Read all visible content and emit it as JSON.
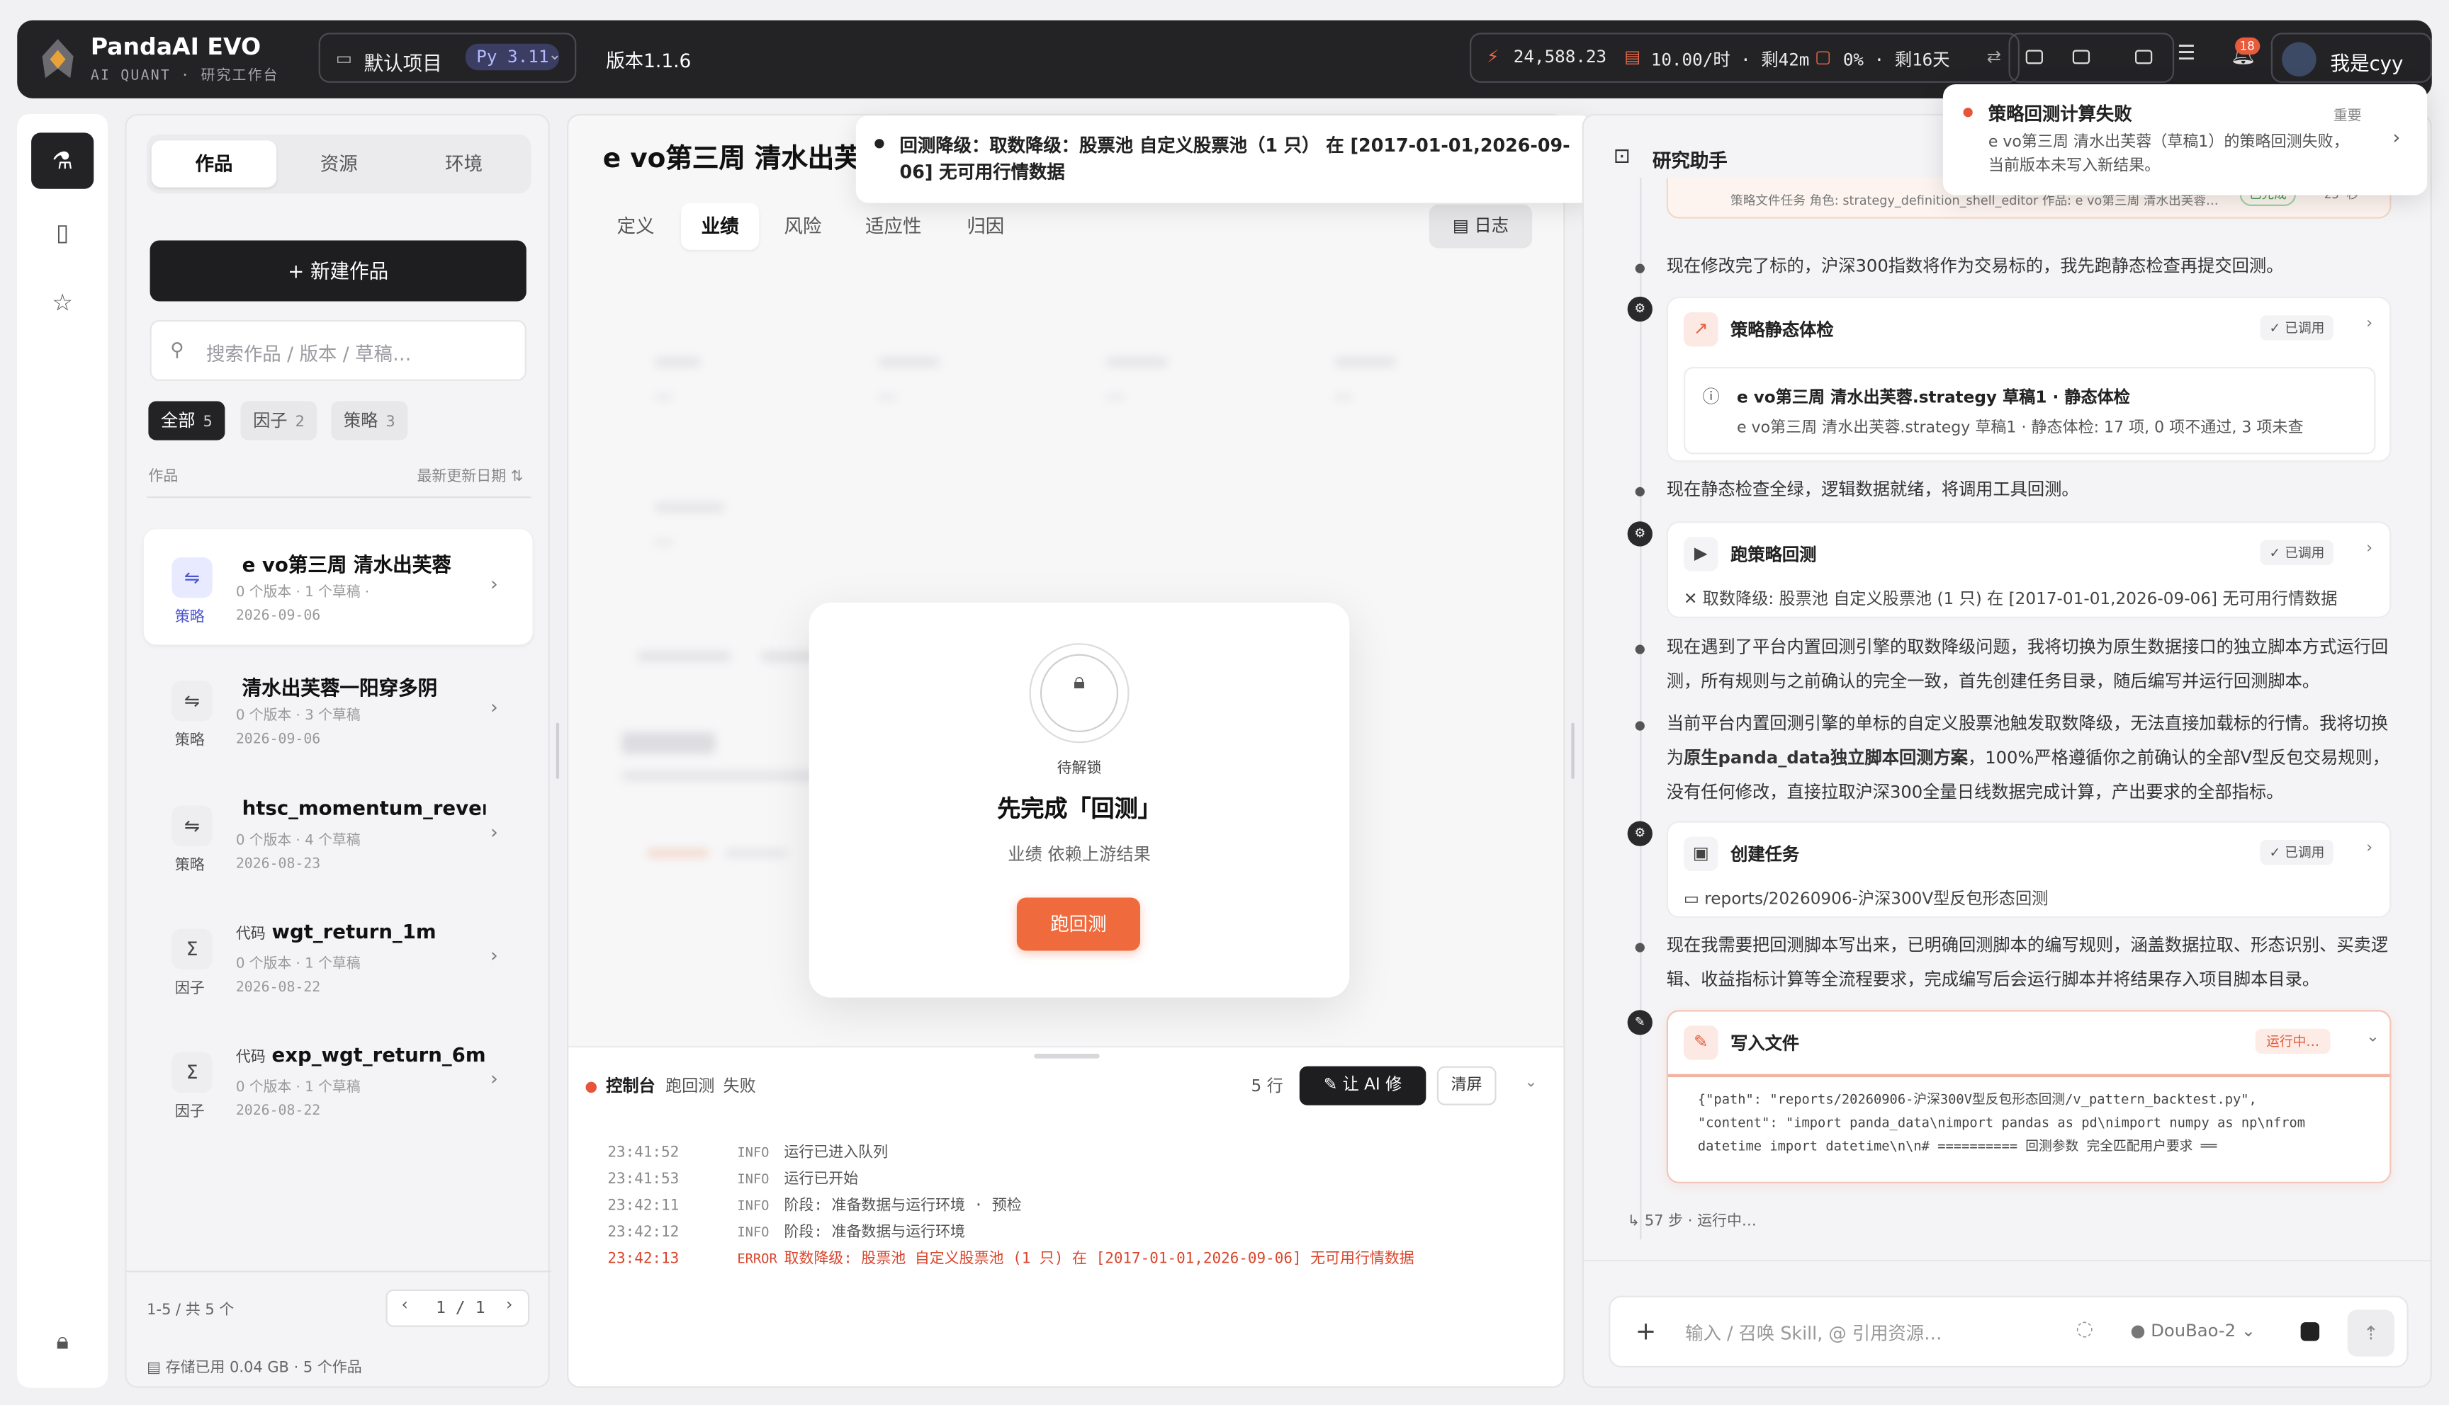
{
  "topbar": {
    "brand": "PandaAI EVO",
    "brand_sub": "AI QUANT · 研究工作台",
    "project_name": "默认项目",
    "python_version": "Py 3.11",
    "version": "版本1.1.6",
    "balance": "24,588.23",
    "rate": "10.00/时 · 剩42m",
    "usage": "0% · 剩16天",
    "notification_count": "18",
    "username": "我是cyy"
  },
  "rail": {
    "items": [
      "flask-icon",
      "notebook-icon",
      "star-icon"
    ],
    "bottom": "lock-icon"
  },
  "left_panel": {
    "tabs": [
      "作品",
      "资源",
      "环境"
    ],
    "active_tab": "作品",
    "new_button": "+ 新建作品",
    "search_placeholder": "搜索作品 / 版本 / 草稿…",
    "filters": [
      {
        "label": "全部",
        "count": "5"
      },
      {
        "label": "因子",
        "count": "2"
      },
      {
        "label": "策略",
        "count": "3"
      }
    ],
    "list_header_left": "作品",
    "list_header_right": "最新更新日期 ⇅",
    "items": [
      {
        "title": "e vo第三周 清水出芙蓉",
        "tag": "",
        "meta": "0 个版本 · 1 个草稿 ·",
        "date": "2026-09-06",
        "type": "策略",
        "icon": "⇋"
      },
      {
        "title": "清水出芙蓉一阳穿多阴",
        "tag": "",
        "meta": "0 个版本 · 3 个草稿",
        "date": "2026-09-06",
        "type": "策略",
        "icon": "⇋"
      },
      {
        "title": "htsc_momentum_revers…",
        "tag": "",
        "meta": "0 个版本 · 4 个草稿",
        "date": "2026-08-23",
        "type": "策略",
        "icon": "⇋"
      },
      {
        "title": "wgt_return_1m",
        "tag": "代码",
        "meta": "0 个版本 · 1 个草稿",
        "date": "2026-08-22",
        "type": "因子",
        "icon": "Σ"
      },
      {
        "title": "exp_wgt_return_6m",
        "tag": "代码",
        "meta": "0 个版本 · 1 个草稿",
        "date": "2026-08-22",
        "type": "因子",
        "icon": "Σ"
      }
    ],
    "pager_text": "1-5 / 共 5 个",
    "page": "1 / 1",
    "storage": "存储已用 0.04 GB · 5 个作品"
  },
  "main": {
    "title": "e vo第三周 清水出芙蓉",
    "tabs": [
      "定义",
      "业绩",
      "风险",
      "适应性",
      "归因"
    ],
    "active_tab": "业绩",
    "log_button": "日志",
    "modal": {
      "label": "待解锁",
      "heading": "先完成「回测」",
      "subtitle": "业绩 依赖上游结果",
      "button": "跑回测"
    },
    "console": {
      "title": "控制台",
      "task": "跑回测",
      "status": "失败",
      "rows": "5 行",
      "ai_fix": "让 AI 修",
      "clear": "清屏",
      "logs": [
        {
          "time": "23:41:52",
          "level": "INFO",
          "msg": "运行已进入队列"
        },
        {
          "time": "23:41:53",
          "level": "INFO",
          "msg": "运行已开始"
        },
        {
          "time": "23:42:11",
          "level": "INFO",
          "msg": "阶段: 准备数据与运行环境 · 预检"
        },
        {
          "time": "23:42:12",
          "level": "INFO",
          "msg": "阶段: 准备数据与运行环境"
        },
        {
          "time": "23:42:13",
          "level": "ERROR",
          "msg": "取数降级: 股票池 自定义股票池 (1 只) 在 [2017-01-01,2026-09-06] 无可用行情数据"
        }
      ]
    }
  },
  "toast_main": {
    "text": "回测降级：取数降级：股票池 自定义股票池（1 只） 在 [2017-01-01,2026-09-06] 无可用行情数据"
  },
  "assistant": {
    "title": "研究助手",
    "prev_card_text": "策略文件任务 角色: strategy_definition_shell_editor 作品: e vo第三周 清水出芙蓉…",
    "prev_card_tag": "已完成",
    "prev_card_time": "25 秒",
    "msg1": "现在修改完了标的，沪深300指数将作为交易标的，我先跑静态检查再提交回测。",
    "card_static": {
      "title": "策略静态体检",
      "status": "✓ 已调用",
      "inner_title": "e vo第三周 清水出芙蓉.strategy 草稿1 · 静态体检",
      "inner_detail": "e vo第三周 清水出芙蓉.strategy 草稿1 · 静态体检: 17 项, 0 项不通过, 3 项未查"
    },
    "msg2": "现在静态检查全绿，逻辑数据就绪，将调用工具回测。",
    "card_backtest": {
      "title": "跑策略回测",
      "status": "✓ 已调用",
      "detail": "✕ 取数降级: 股票池 自定义股票池 (1 只) 在 [2017-01-01,2026-09-06] 无可用行情数据"
    },
    "msg3": "现在遇到了平台内置回测引擎的取数降级问题，我将切换为原生数据接口的独立脚本方式运行回测，所有规则与之前确认的完全一致，首先创建任务目录，随后编写并运行回测脚本。",
    "msg4_a": "当前平台内置回测引擎的单标的自定义股票池触发取数降级，无法直接加载标的行情。我将切换为",
    "msg4_bold": "原生panda_data独立脚本回测方案",
    "msg4_b": "，100%严格遵循你之前确认的全部V型反包交易规则，没有任何修改，直接拉取沪深300全量日线数据完成计算，产出要求的全部指标。",
    "card_task": {
      "title": "创建任务",
      "status": "✓ 已调用",
      "detail": "reports/20260906-沪深300V型反包形态回测"
    },
    "msg5": "现在我需要把回测脚本写出来，已明确回测脚本的编写规则，涵盖数据拉取、形态识别、买卖逻辑、收益指标计算等全流程要求，完成编写后会运行脚本并将结果存入项目脚本目录。",
    "card_write": {
      "title": "写入文件",
      "status": "运行中…",
      "code_line1": "{\"path\": \"reports/20260906-沪深300V型反包形态回测/v_pattern_backtest.py\",",
      "code_line2": "\"content\": \"import panda_data\\nimport pandas as pd\\nimport numpy as np\\nfrom",
      "code_line3": "datetime import datetime\\n\\n# ========== 回测参数 完全匹配用户要求 ══"
    },
    "steps": "57 步 · 运行中…",
    "input_placeholder": "输入 / 召唤 Skill, @ 引用资源…",
    "model": "● DouBao-2 ⌄"
  },
  "toast_right": {
    "title": "策略回测计算失败",
    "importance": "重要",
    "body": "e vo第三周 清水出芙蓉（草稿1）的策略回测失败，当前版本未写入新结果。"
  },
  "colors": {
    "accent": "#ef6a3d",
    "error": "#d9452c",
    "dark": "#232326",
    "success": "#3b9a4b"
  }
}
